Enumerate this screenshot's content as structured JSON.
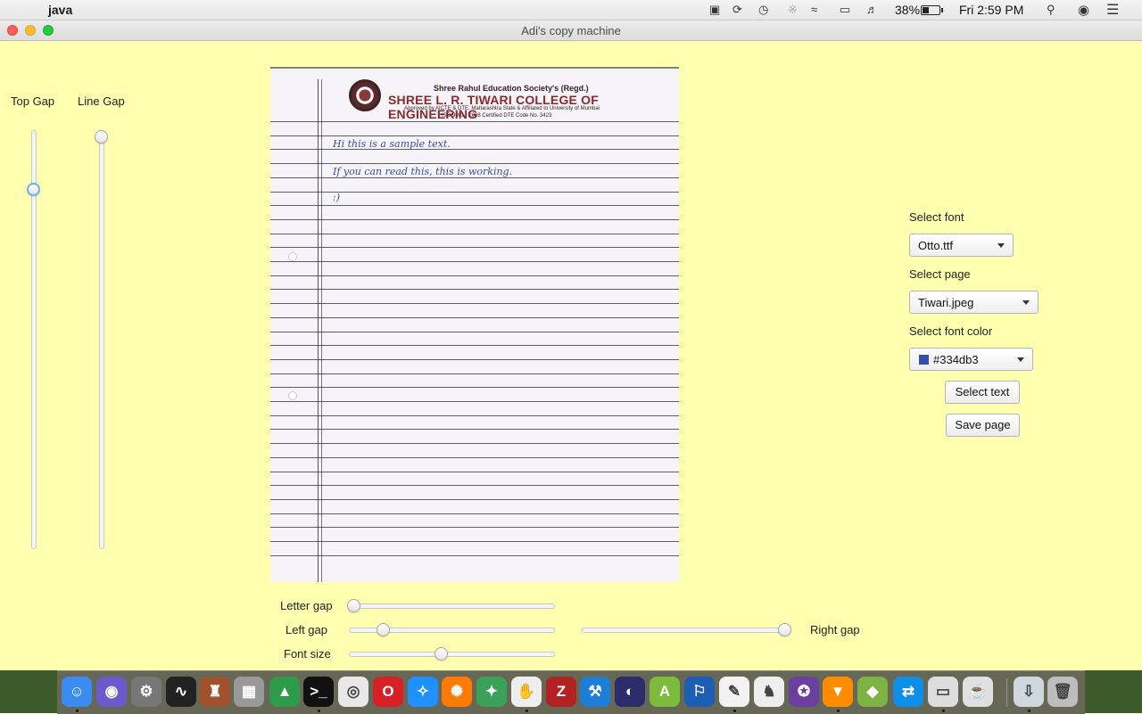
{
  "menubar": {
    "apple_glyph": "",
    "app_name": "java",
    "battery_percent": "38%",
    "clock": "Fri 2:59 PM"
  },
  "window": {
    "title": "Adi's copy machine"
  },
  "sliders": {
    "top_gap_label": "Top Gap",
    "line_gap_label": "Line Gap",
    "letter_gap_label": "Letter gap",
    "left_gap_label": "Left gap",
    "right_gap_label": "Right gap",
    "font_size_label": "Font size",
    "top_gap_value": 0.87,
    "line_gap_value": 1.0,
    "letter_gap_value": 0.0,
    "left_gap_value": 0.15,
    "right_gap_value": 1.0,
    "font_size_value": 0.45
  },
  "page": {
    "header_line1": "Shree Rahul Education Society's (Regd.)",
    "header_line2": "SHREE L. R. TIWARI COLLEGE OF ENGINEERING",
    "header_line3": "Approved by AICTE & DTE, Maharashtra State & Affiliated to University of Mumbai",
    "header_line4": "ISO 9001 : 2008 Certified   DTE Code No. 3423",
    "handwriting": [
      "Hi this is a sample text.",
      "If you can read this, this is working.",
      ":)"
    ],
    "ink_color": "#334db3"
  },
  "controls": {
    "select_font_label": "Select font",
    "font_value": "Otto.ttf",
    "select_page_label": "Select page",
    "page_value": "Tiwari.jpeg",
    "select_font_color_label": "Select font color",
    "font_color_value": "#334db3",
    "select_text_button": "Select text",
    "save_page_button": "Save page"
  },
  "dock": {
    "icons": [
      "finder-icon",
      "siri-icon",
      "system-preferences-icon",
      "activity-monitor-icon",
      "user-app-icon",
      "app-icon",
      "google-drive-icon",
      "terminal-icon",
      "chrome-icon",
      "opera-icon",
      "safari-icon",
      "firefox-icon",
      "globe-icon",
      "hand-icon",
      "filezilla-icon",
      "xcode-icon",
      "eclipse-icon",
      "android-studio-icon",
      "sourcetree-icon",
      "textedit-icon",
      "sequel-pro-icon",
      "github-icon",
      "vlc-icon",
      "android-file-transfer-icon",
      "teamviewer-icon",
      "scanner-icon",
      "coffee-icon",
      "downloads-icon",
      "trash-icon"
    ]
  }
}
